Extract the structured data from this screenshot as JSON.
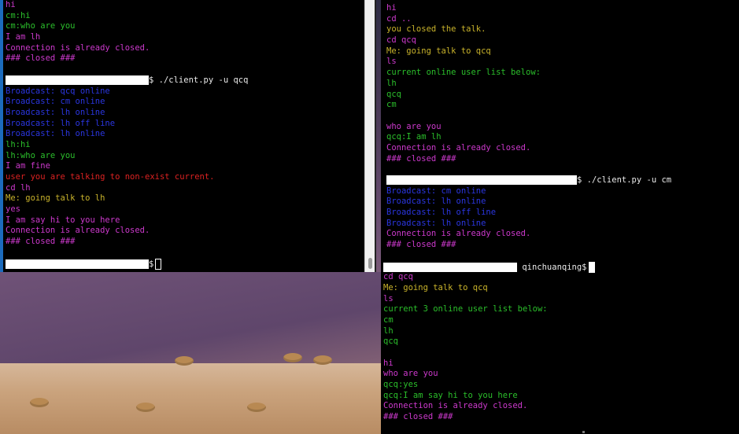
{
  "left_terminal": {
    "lines_before_prompt": [
      {
        "text": "hi",
        "color": "magenta"
      },
      {
        "text": "cm:hi",
        "color": "green"
      },
      {
        "text": "cm:who are you",
        "color": "green"
      },
      {
        "text": "I am lh",
        "color": "magenta"
      },
      {
        "text": "Connection is already closed.",
        "color": "magenta"
      },
      {
        "text": "### closed ###",
        "color": "magenta"
      }
    ],
    "prompt_command": "$ ./client.py -u qcq",
    "lines_after_prompt": [
      {
        "text": "Broadcast: qcq online",
        "color": "blue"
      },
      {
        "text": "Broadcast: cm online",
        "color": "blue"
      },
      {
        "text": "Broadcast: lh online",
        "color": "blue"
      },
      {
        "text": "Broadcast: lh off line",
        "color": "blue"
      },
      {
        "text": "Broadcast: lh online",
        "color": "blue"
      },
      {
        "text": "lh:hi",
        "color": "green"
      },
      {
        "text": "lh:who are you",
        "color": "green"
      },
      {
        "text": "I am fine",
        "color": "magenta"
      },
      {
        "text": "user you are talking to non-exist current.",
        "color": "red"
      },
      {
        "text": "cd lh",
        "color": "magenta"
      },
      {
        "text": "Me: going talk to lh",
        "color": "yellow"
      },
      {
        "text": "yes",
        "color": "magenta"
      },
      {
        "text": "I am say hi to you here",
        "color": "magenta"
      },
      {
        "text": "Connection is already closed.",
        "color": "magenta"
      },
      {
        "text": "### closed ###",
        "color": "magenta"
      }
    ],
    "final_prompt_symbol": "$"
  },
  "right_terminal": {
    "lines_block1": [
      {
        "text": "hi",
        "color": "magenta"
      },
      {
        "text": "cd ..",
        "color": "magenta"
      },
      {
        "text": "you closed the talk.",
        "color": "yellow"
      },
      {
        "text": "cd qcq",
        "color": "magenta"
      },
      {
        "text": "Me: going talk to qcq",
        "color": "yellow"
      },
      {
        "text": "ls",
        "color": "magenta"
      },
      {
        "text": "current online user list below:",
        "color": "green"
      },
      {
        "text": "lh",
        "color": "green"
      },
      {
        "text": "qcq",
        "color": "green"
      },
      {
        "text": "cm",
        "color": "green"
      }
    ],
    "lines_block2": [
      {
        "text": "who are you",
        "color": "magenta"
      },
      {
        "text": "qcq:I am lh",
        "color": "green"
      },
      {
        "text": "Connection is already closed.",
        "color": "magenta"
      },
      {
        "text": "### closed ###",
        "color": "magenta"
      }
    ],
    "prompt_command": "$ ./client.py -u cm",
    "lines_block3": [
      {
        "text": "Broadcast: cm online",
        "color": "blue"
      },
      {
        "text": "Broadcast: lh online",
        "color": "blue"
      },
      {
        "text": "Broadcast: lh off line",
        "color": "blue"
      },
      {
        "text": "Broadcast: lh online",
        "color": "blue"
      },
      {
        "text": "Connection is already closed.",
        "color": "magenta"
      },
      {
        "text": "### closed ###",
        "color": "magenta"
      }
    ],
    "prompt_user": "qinchuanqing$",
    "lines_block4": [
      {
        "text": "cd qcq",
        "color": "magenta"
      },
      {
        "text": "Me: going talk to qcq",
        "color": "yellow"
      },
      {
        "text": "ls",
        "color": "magenta"
      },
      {
        "text": "current 3 online user list below:",
        "color": "green"
      },
      {
        "text": "cm",
        "color": "green"
      },
      {
        "text": "lh",
        "color": "green"
      },
      {
        "text": "qcq",
        "color": "green"
      }
    ],
    "lines_block5": [
      {
        "text": "hi",
        "color": "magenta"
      },
      {
        "text": "who are you",
        "color": "magenta"
      },
      {
        "text": "qcq:yes",
        "color": "green"
      },
      {
        "text": "qcq:I am say hi to you here",
        "color": "green"
      },
      {
        "text": "Connection is already closed.",
        "color": "magenta"
      },
      {
        "text": "### closed ###",
        "color": "magenta"
      }
    ]
  },
  "colors": {
    "magenta": "#cc39cc",
    "green": "#2bbf2b",
    "blue": "#2b36e1",
    "yellow": "#c9b32b",
    "red": "#dd2222",
    "white": "#eaeaea",
    "terminal_bg": "#000000"
  }
}
